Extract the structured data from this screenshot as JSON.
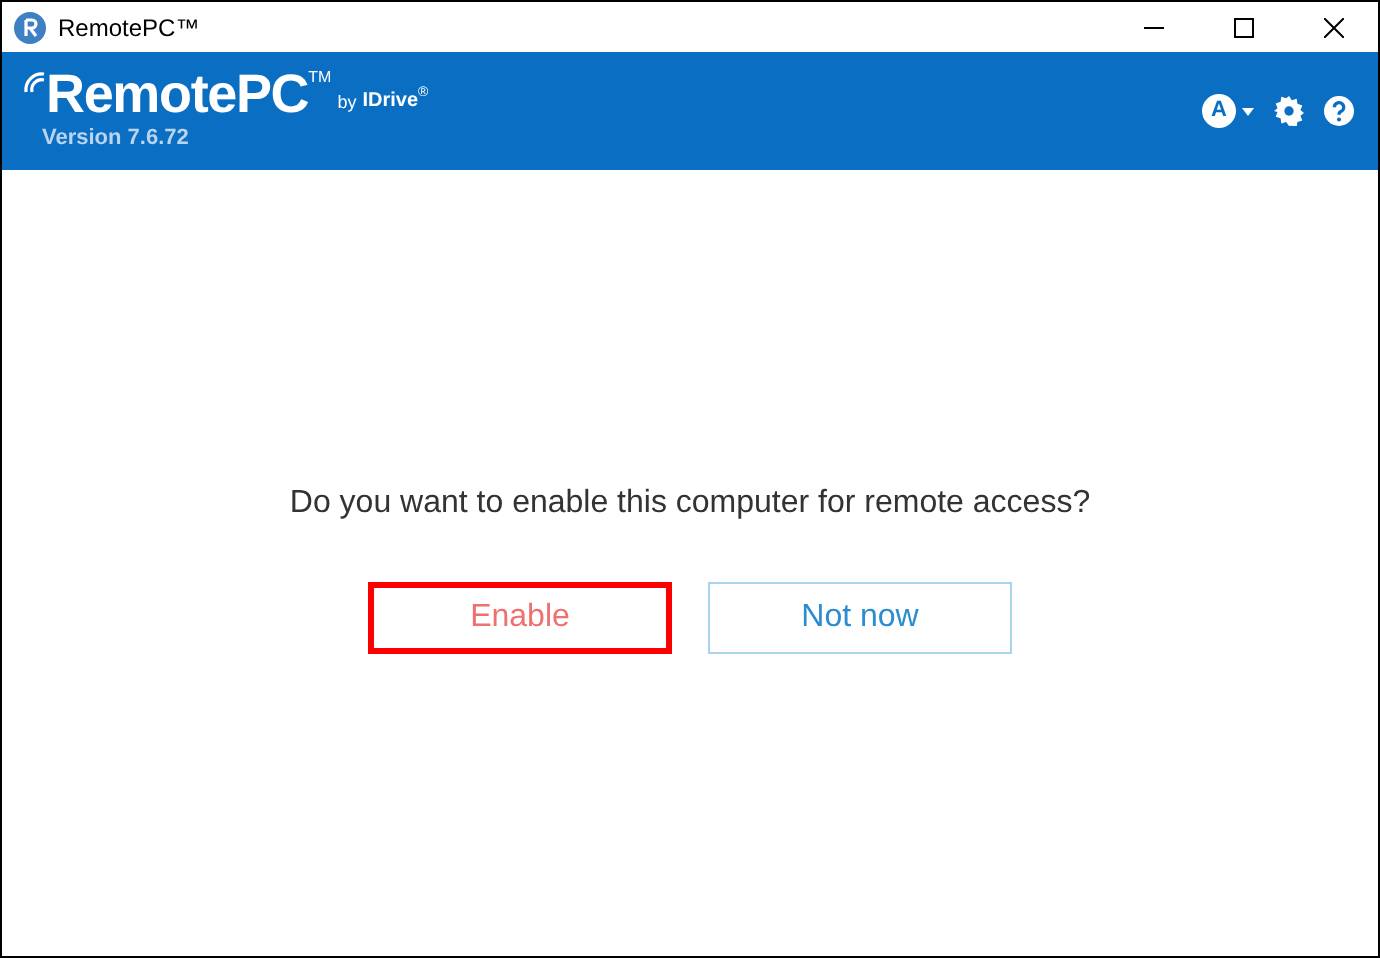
{
  "window": {
    "title": "RemotePC™"
  },
  "header": {
    "logo_text": "RemotePC",
    "trademark": "TM",
    "by_text": "by",
    "brand": "IDrive",
    "registered": "®",
    "version": "Version 7.6.72",
    "avatar_letter": "A"
  },
  "prompt": "Do you want to enable this computer for remote access?",
  "buttons": [
    {
      "label": "Enable",
      "highlighted": true
    },
    {
      "label": "Not now",
      "highlighted": false
    }
  ]
}
